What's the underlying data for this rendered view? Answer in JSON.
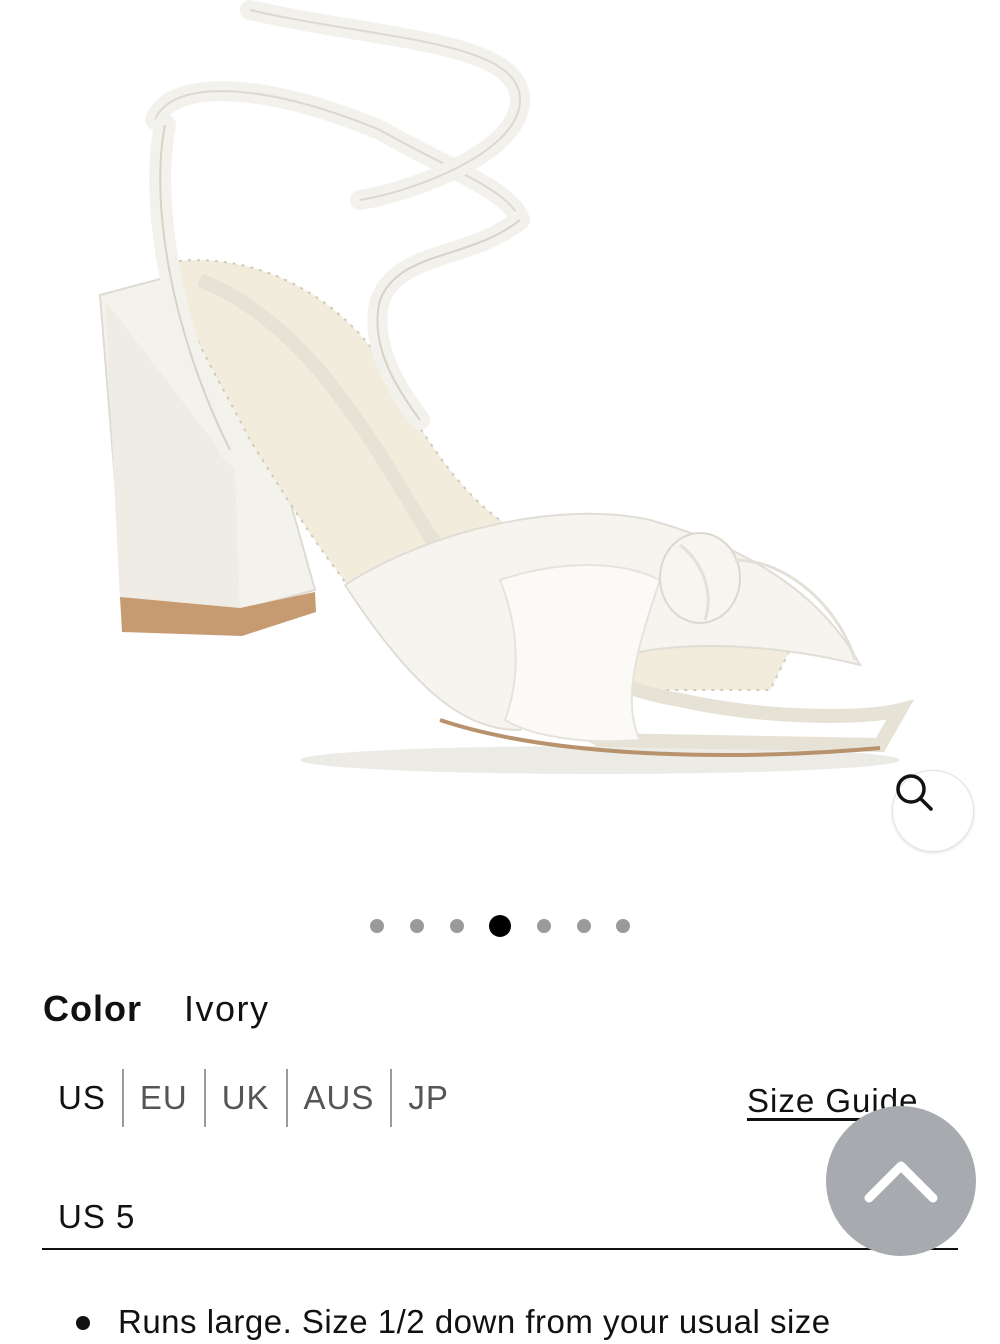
{
  "gallery": {
    "image_alt": "Ivory satin knot sandal with block heel",
    "dots": 7,
    "active_index": 3,
    "zoom_icon": "magnifier-icon"
  },
  "product": {
    "color_label": "Color",
    "color_value": "Ivory"
  },
  "sizes": {
    "tabs": [
      "US",
      "EU",
      "UK",
      "AUS",
      "JP"
    ],
    "selected_tab": "US",
    "guide_label": "Size Guide",
    "selected_size": "US 5"
  },
  "notes": [
    "Runs large. Size 1/2 down from your usual size"
  ],
  "back_to_top_icon": "chevron-up-icon"
}
